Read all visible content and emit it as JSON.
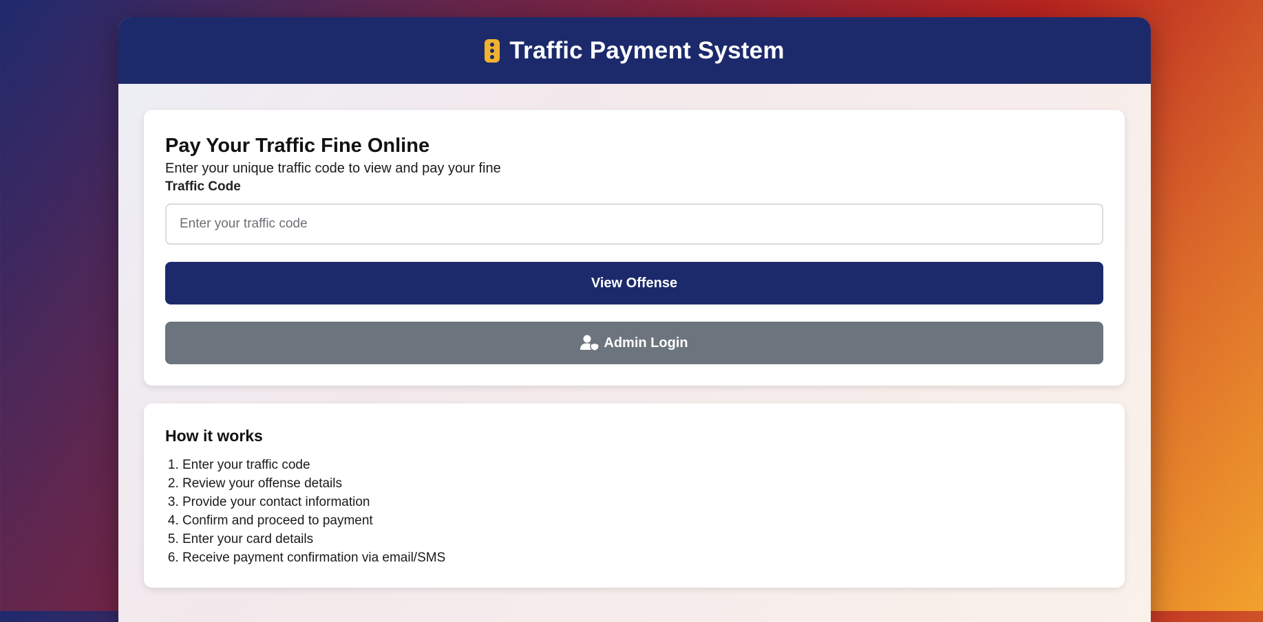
{
  "header": {
    "title": "Traffic Payment System",
    "icon": "traffic-light-icon",
    "background": "#1c2a6b",
    "icon_color": "#f2b230"
  },
  "form": {
    "title": "Pay Your Traffic Fine Online",
    "subtitle": "Enter your unique traffic code to view and pay your fine",
    "code_label": "Traffic Code",
    "code_value": "",
    "code_placeholder": "Enter your traffic code",
    "view_button_label": "View Offense",
    "view_button_color": "#1c2a6b",
    "admin_button_label": "Admin Login",
    "admin_button_icon": "user-shield-icon",
    "admin_button_color": "#6c757d"
  },
  "how_it_works": {
    "title": "How it works",
    "steps": [
      "Enter your traffic code",
      "Review your offense details",
      "Provide your contact information",
      "Confirm and proceed to payment",
      "Enter your card details",
      "Receive payment confirmation via email/SMS"
    ]
  }
}
